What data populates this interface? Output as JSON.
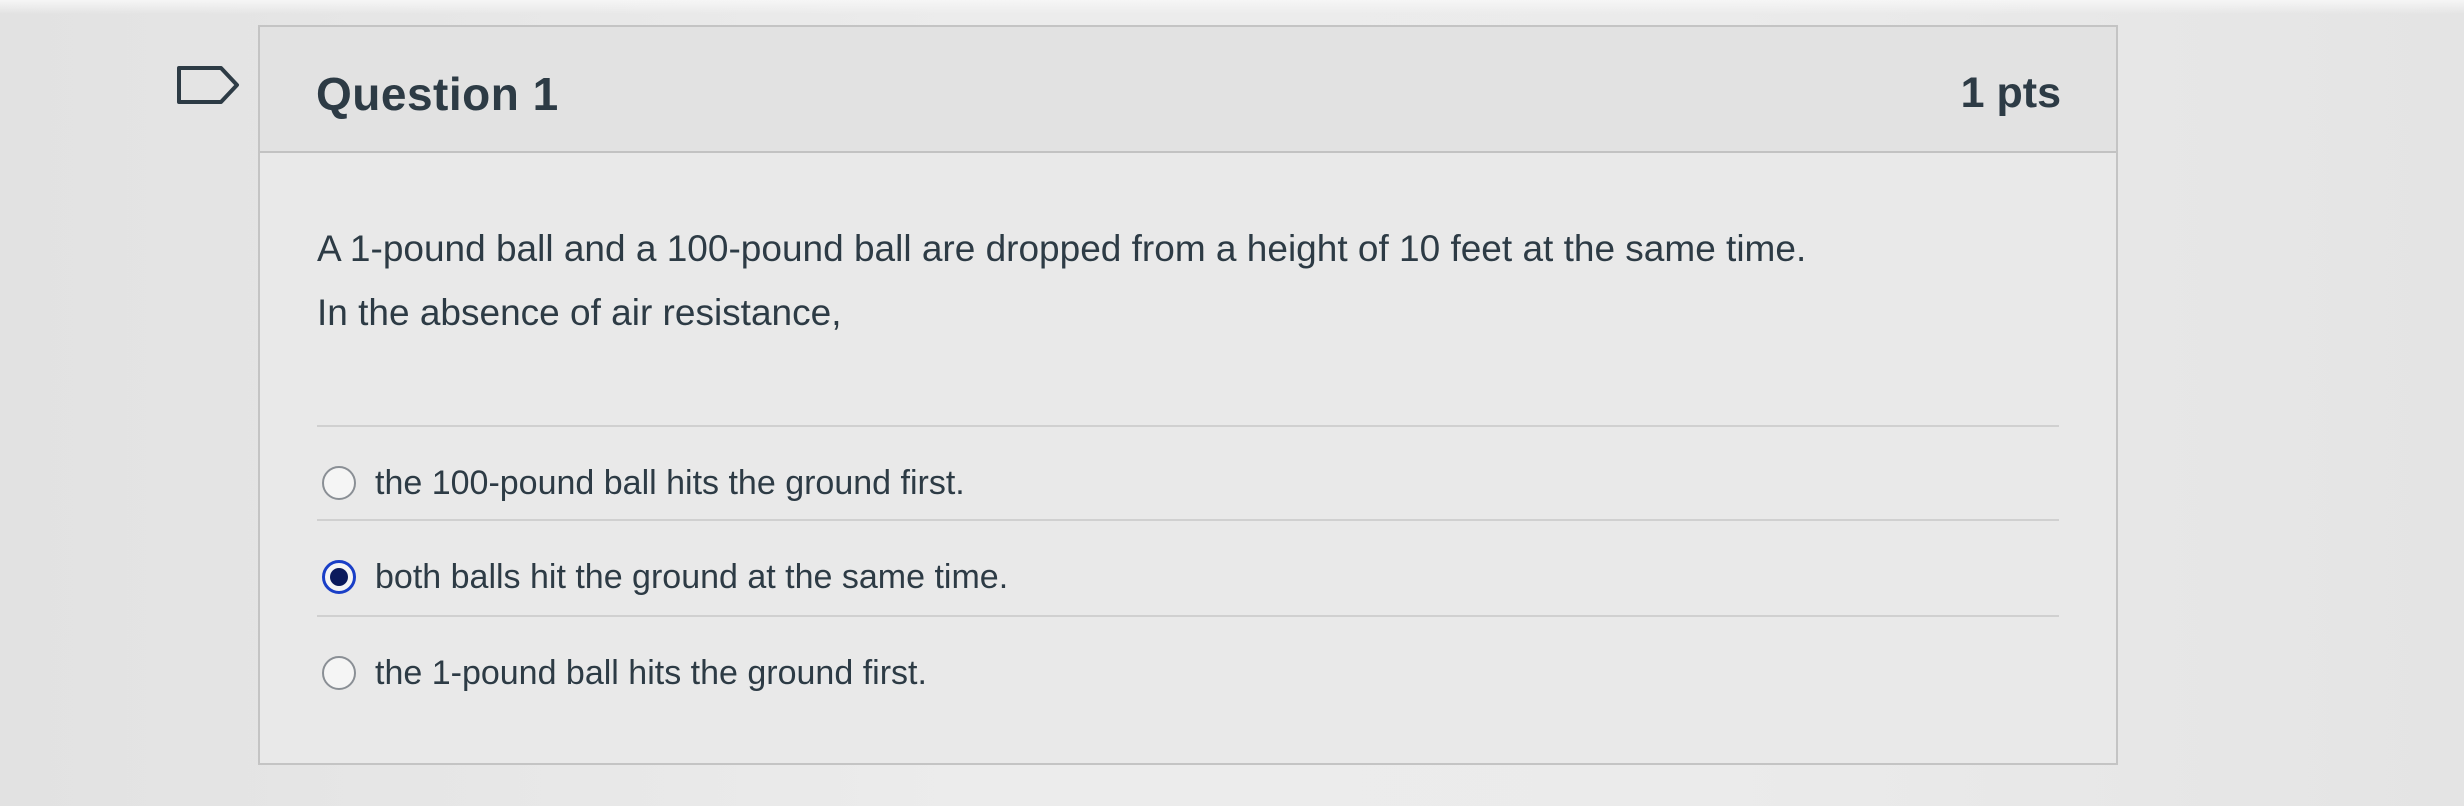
{
  "question": {
    "title": "Question 1",
    "points": "1 pts",
    "flag_icon": "bookmark-flag-icon",
    "text_line1": "A 1-pound ball and a 100-pound ball are dropped from a height of 10 feet at the same time.",
    "text_line2": "In the absence of air resistance,"
  },
  "answers": [
    {
      "label": "the 100-pound ball hits the ground first.",
      "selected": false
    },
    {
      "label": "both balls hit the ground at the same time.",
      "selected": true
    },
    {
      "label": "the 1-pound ball hits the ground first.",
      "selected": false
    }
  ],
  "colors": {
    "text": "#2d3b45",
    "radio_selected": "#1a3fc7",
    "border": "#c4c4c4"
  }
}
